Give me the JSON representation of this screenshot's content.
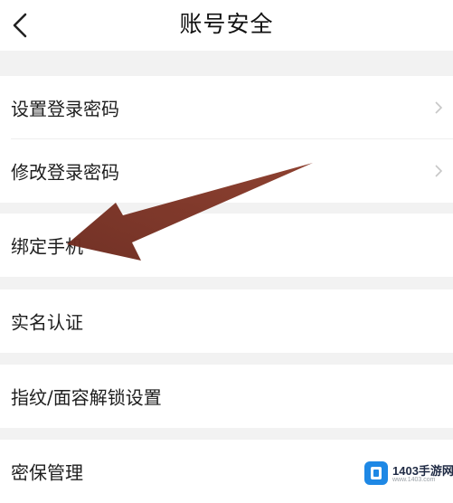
{
  "header": {
    "title": "账号安全",
    "back_icon": "chevron-left-icon"
  },
  "sections": [
    {
      "items": [
        {
          "label": "设置登录密码",
          "has_chevron": true
        },
        {
          "label": "修改登录密码",
          "has_chevron": true
        }
      ]
    },
    {
      "items": [
        {
          "label": "绑定手机",
          "has_chevron": false
        }
      ]
    },
    {
      "items": [
        {
          "label": "实名认证",
          "has_chevron": false
        }
      ]
    },
    {
      "items": [
        {
          "label": "指纹/面容解锁设置",
          "has_chevron": false
        }
      ]
    },
    {
      "items": [
        {
          "label": "密保管理",
          "has_chevron": false
        }
      ]
    }
  ],
  "annotation": {
    "arrow_color": "#7b3324"
  },
  "watermark": {
    "text": "1403手游网",
    "sub": "www.1403.com",
    "logo_color": "#1e88e5"
  }
}
